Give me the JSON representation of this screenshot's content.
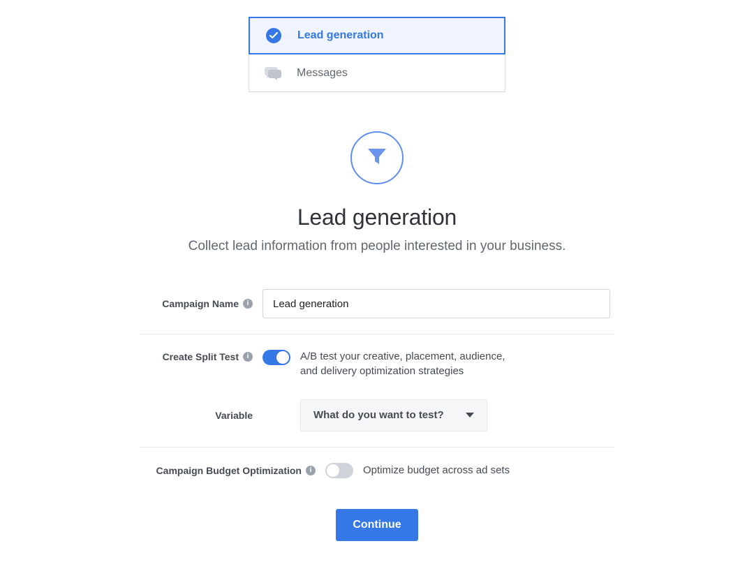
{
  "objectives": {
    "lead_generation": {
      "label": "Lead generation",
      "selected": true
    },
    "messages": {
      "label": "Messages",
      "selected": false
    }
  },
  "hero": {
    "title": "Lead generation",
    "subtitle": "Collect lead information from people interested in your business."
  },
  "form": {
    "campaign_name_label": "Campaign Name",
    "campaign_name_value": "Lead generation",
    "split_test_label": "Create Split Test",
    "split_test_on": true,
    "split_test_desc": "A/B test your creative, placement, audience, and delivery optimization strategies",
    "variable_label": "Variable",
    "variable_placeholder": "What do you want to test?",
    "cbo_label": "Campaign Budget Optimization",
    "cbo_on": false,
    "cbo_desc": "Optimize budget across ad sets",
    "continue_label": "Continue"
  },
  "colors": {
    "accent": "#3578e5",
    "muted": "#606770",
    "border": "#dadce0"
  }
}
